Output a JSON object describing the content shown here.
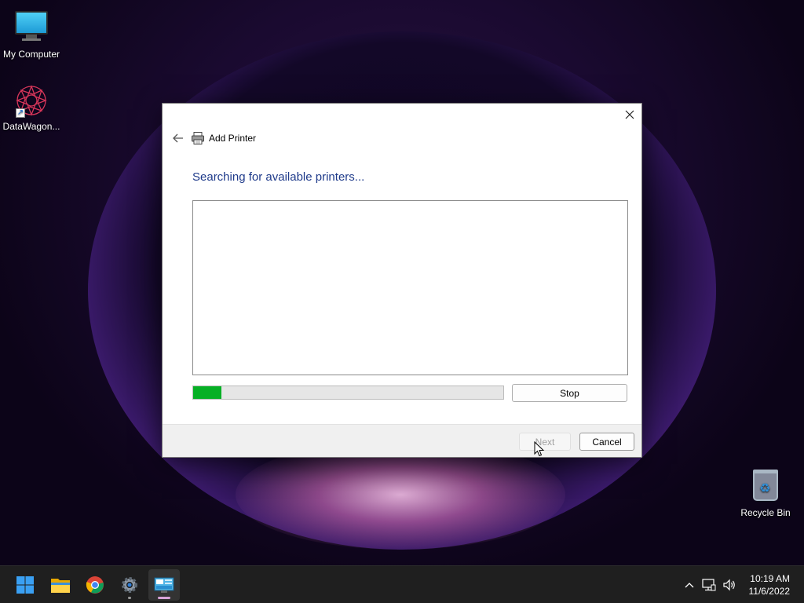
{
  "desktop": {
    "icons": [
      {
        "label": "My Computer"
      },
      {
        "label": "DataWagon..."
      },
      {
        "label": "Recycle Bin"
      }
    ]
  },
  "dialog": {
    "title": "Add Printer",
    "heading": "Searching for available printers...",
    "progress_percent": 9,
    "stop_label": "Stop",
    "next_label": "Next",
    "cancel_label": "Cancel"
  },
  "taskbar": {
    "apps": [
      "start",
      "file-explorer",
      "chrome",
      "settings",
      "control-panel"
    ],
    "time": "10:19 AM",
    "date": "11/6/2022"
  },
  "colors": {
    "heading": "#1e3a8a",
    "progress": "#06b025",
    "taskbar": "#1f1f1f"
  }
}
